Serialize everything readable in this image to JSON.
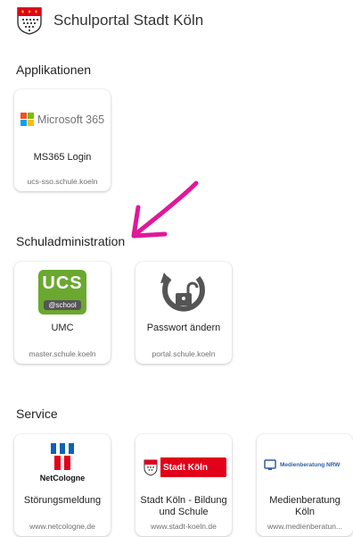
{
  "header": {
    "title": "Schulportal Stadt Köln"
  },
  "sections": [
    {
      "title": "Applikationen",
      "cards": [
        {
          "logo_text": "Microsoft 365",
          "name": "MS365 Login",
          "url": "ucs-sso.schule.koeln"
        }
      ]
    },
    {
      "title": "Schuladministration",
      "cards": [
        {
          "logo_text": "UCS",
          "logo_subtext": "@school",
          "name": "UMC",
          "url": "master.schule.koeln"
        },
        {
          "name": "Passwort ändern",
          "url": "portal.schule.koeln"
        }
      ]
    },
    {
      "title": "Service",
      "cards": [
        {
          "logo_text": "NetCologne",
          "name": "Störungsmeldung",
          "url": "www.netcologne.de"
        },
        {
          "logo_text": "Stadt Köln",
          "name": "Stadt Köln - Bildung und Schule",
          "url": "www.stadt-koeln.de"
        },
        {
          "logo_text": "Medienberatung NRW",
          "name": "Medienberatung Köln",
          "url": "www.medienberatun..."
        }
      ]
    }
  ],
  "colors": {
    "accent_arrow": "#e0189a",
    "ucs_green": "#6aa82f",
    "koeln_red": "#e2001a",
    "netcologne_blue": "#0e63b5"
  },
  "icons": [
    "koeln-coat-of-arms-icon",
    "microsoft-logo-icon",
    "unlock-reset-icon",
    "arrow-annotation"
  ]
}
